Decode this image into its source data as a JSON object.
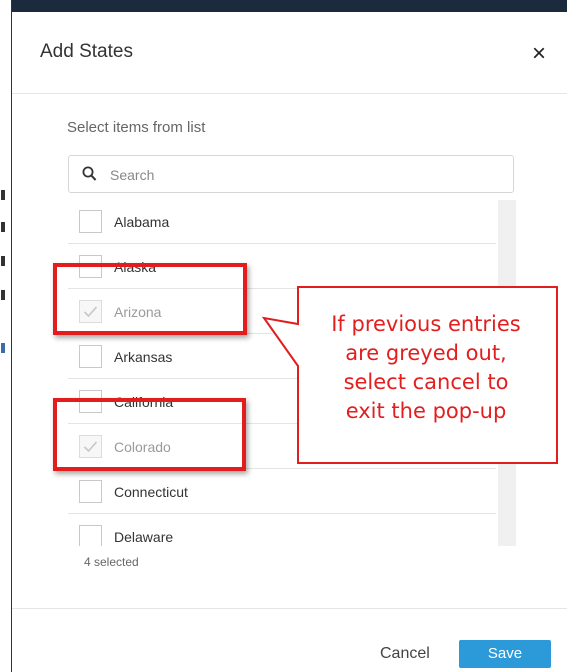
{
  "dialog": {
    "title": "Add States",
    "close_label": "×",
    "instruction": "Select items from list",
    "search": {
      "placeholder": "Search",
      "value": ""
    },
    "items": [
      {
        "label": "Alabama",
        "checked": false,
        "disabled": false
      },
      {
        "label": "Alaska",
        "checked": false,
        "disabled": false
      },
      {
        "label": "Arizona",
        "checked": true,
        "disabled": true
      },
      {
        "label": "Arkansas",
        "checked": false,
        "disabled": false
      },
      {
        "label": "California",
        "checked": false,
        "disabled": false
      },
      {
        "label": "Colorado",
        "checked": true,
        "disabled": true
      },
      {
        "label": "Connecticut",
        "checked": false,
        "disabled": false
      },
      {
        "label": "Delaware",
        "checked": false,
        "disabled": false
      }
    ],
    "selected_count": "4 selected",
    "cancel_label": "Cancel",
    "save_label": "Save"
  },
  "annotation": {
    "lines": [
      "If previous entries",
      "are greyed out,",
      "select cancel to",
      "exit the pop-up"
    ],
    "color": "#e31e1e"
  },
  "colors": {
    "accent": "#2c9ad9",
    "highlight": "#e11d1d",
    "topbar": "#1b2a3d"
  },
  "icons": {
    "search": "search-icon",
    "close": "close-icon",
    "check": "check-icon"
  }
}
